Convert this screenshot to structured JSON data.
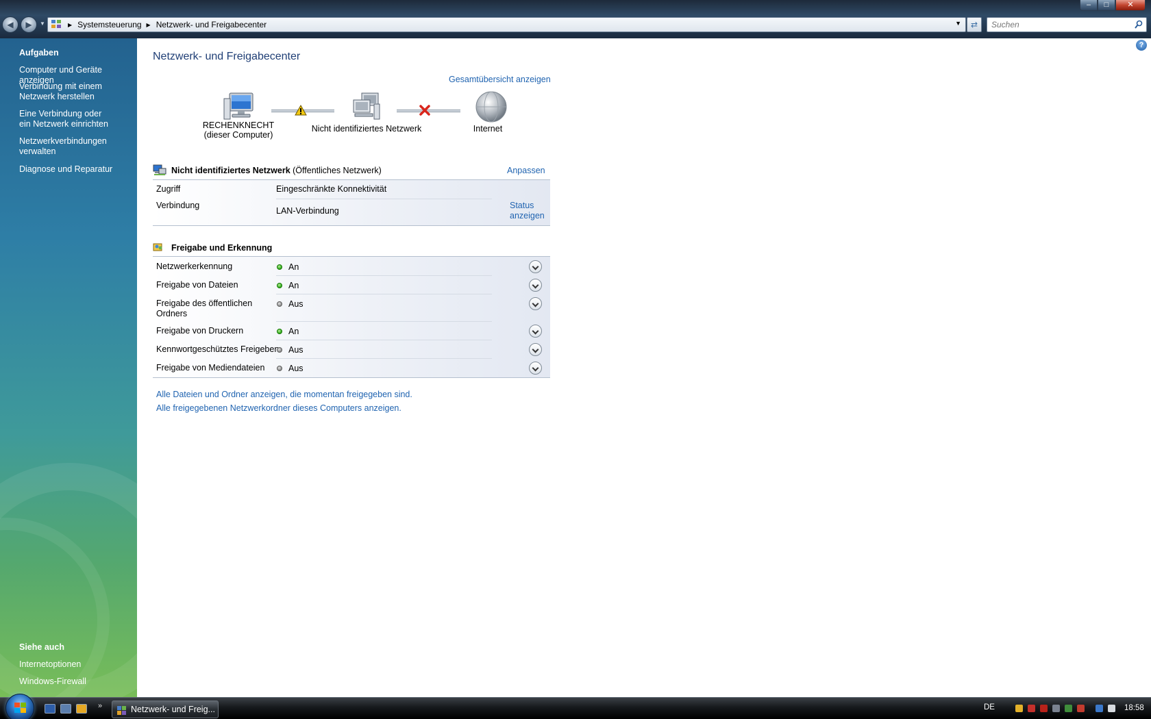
{
  "address_bar": {
    "crumbs": [
      "Systemsteuerung",
      "Netzwerk- und Freigabecenter"
    ],
    "search_placeholder": "Suchen"
  },
  "sidebar": {
    "tasks_heading": "Aufgaben",
    "tasks": [
      "Computer und Geräte anzeigen",
      "Verbindung mit einem Netzwerk herstellen",
      "Eine Verbindung oder ein Netzwerk einrichten",
      "Netzwerkverbindungen verwalten",
      "Diagnose und Reparatur"
    ],
    "see_also_heading": "Siehe auch",
    "see_also": [
      "Internetoptionen",
      "Windows-Firewall"
    ]
  },
  "main": {
    "title": "Netzwerk- und Freigabecenter",
    "overview_link": "Gesamtübersicht anzeigen",
    "map": {
      "computer_name": "RECHENKNECHT",
      "computer_sub": "(dieser Computer)",
      "network_name": "Nicht identifiziertes Netzwerk",
      "internet_name": "Internet"
    },
    "network": {
      "name": "Nicht identifiziertes Netzwerk",
      "type": "(Öffentliches Netzwerk)",
      "customize_link": "Anpassen",
      "access_label": "Zugriff",
      "access_value": "Eingeschränkte Konnektivität",
      "connection_label": "Verbindung",
      "connection_value": "LAN-Verbindung",
      "status_link": "Status anzeigen"
    },
    "sharing": {
      "title": "Freigabe und Erkennung",
      "rows": [
        {
          "label": "Netzwerkerkennung",
          "state": "An"
        },
        {
          "label": "Freigabe von Dateien",
          "state": "An"
        },
        {
          "label": "Freigabe des öffentlichen Ordners",
          "state": "Aus"
        },
        {
          "label": "Freigabe von Druckern",
          "state": "An"
        },
        {
          "label": "Kennwortgeschütztes Freigeben",
          "state": "Aus"
        },
        {
          "label": "Freigabe von Mediendateien",
          "state": "Aus"
        }
      ]
    },
    "links": [
      "Alle Dateien und Ordner anzeigen, die momentan freigegeben sind.",
      "Alle freigegebenen Netzwerkordner dieses Computers anzeigen."
    ]
  },
  "taskbar": {
    "task_title": "Netzwerk- und Freig...",
    "language": "DE",
    "clock": "18:58"
  },
  "colors": {
    "accent_link": "#1f63b0",
    "title_blue": "#1f3e75",
    "status_on": "#2aa516",
    "status_off": "#8d8d8d",
    "error_red": "#d9261c",
    "warning_yellow": "#f2c811"
  }
}
